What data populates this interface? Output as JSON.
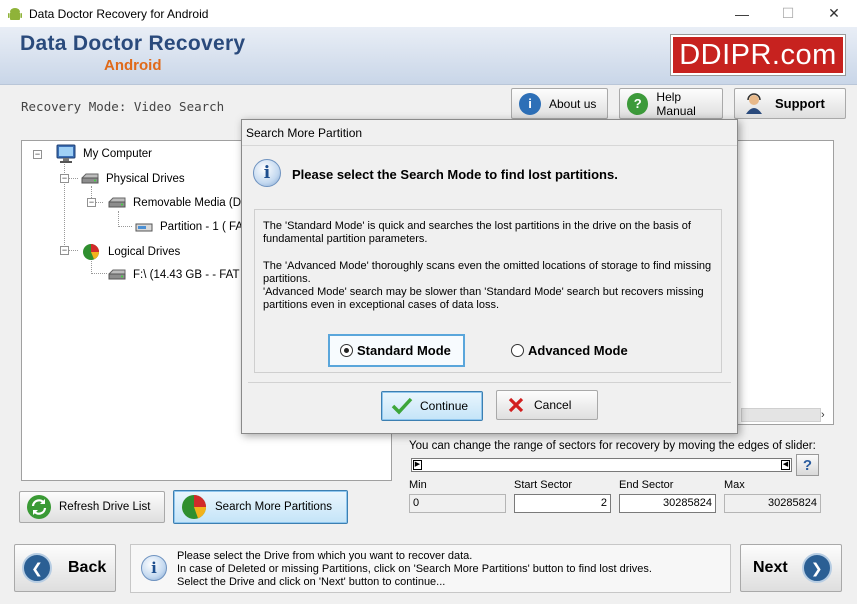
{
  "window": {
    "title": "Data Doctor Recovery for Android",
    "minimize": "—",
    "maximize": "☐",
    "close": "✕"
  },
  "header": {
    "brand_line1": "Data Doctor Recovery",
    "brand_line2": "Android",
    "logo_text": "DDIPR.com",
    "logo_color": "#c7221f"
  },
  "modebar": {
    "mode_label": "Recovery Mode: Video Search",
    "about_label": "About us",
    "help_label": "Help Manual",
    "support_label": "Support"
  },
  "tree": {
    "my_computer": "My Computer",
    "physical_drives": "Physical Drives",
    "removable_media": "Removable Media (Dis",
    "partition_1": "Partition - 1 ( FA",
    "logical_drives": "Logical Drives",
    "f_drive": "F:\\ (14.43 GB -  - FAT"
  },
  "sector": {
    "message": "You can change the range of sectors for recovery by moving the edges of slider:",
    "help_glyph": "?",
    "min_label": "Min",
    "start_label": "Start Sector",
    "end_label": "End Sector",
    "max_label": "Max",
    "min_value": "0",
    "start_value": "2",
    "end_value": "30285824",
    "max_value": "30285824"
  },
  "buttons": {
    "refresh": "Refresh Drive List",
    "search_more": "Search More Partitions",
    "back": "Back",
    "next": "Next"
  },
  "info": {
    "line1": "Please select the Drive from which you want to recover data.",
    "line2": "In case of Deleted or missing Partitions, click on 'Search More Partitions' button to find lost drives.",
    "line3": "Select the Drive and click on 'Next' button to continue..."
  },
  "modal": {
    "title": "Search More Partition",
    "heading": "Please select the Search Mode to find lost partitions.",
    "para1": "The 'Standard Mode' is quick and searches the lost partitions in the drive on the basis of fundamental partition parameters.",
    "para2": "The 'Advanced Mode' thoroughly scans even the omitted locations of  storage to find missing partitions.",
    "para3": "'Advanced Mode' search may be slower than 'Standard Mode' search but recovers missing partitions even in exceptional cases of data loss.",
    "standard_mode": "Standard Mode",
    "advanced_mode": "Advanced Mode",
    "selected_mode": "Standard Mode",
    "continue_label": "Continue",
    "cancel_label": "Cancel"
  }
}
